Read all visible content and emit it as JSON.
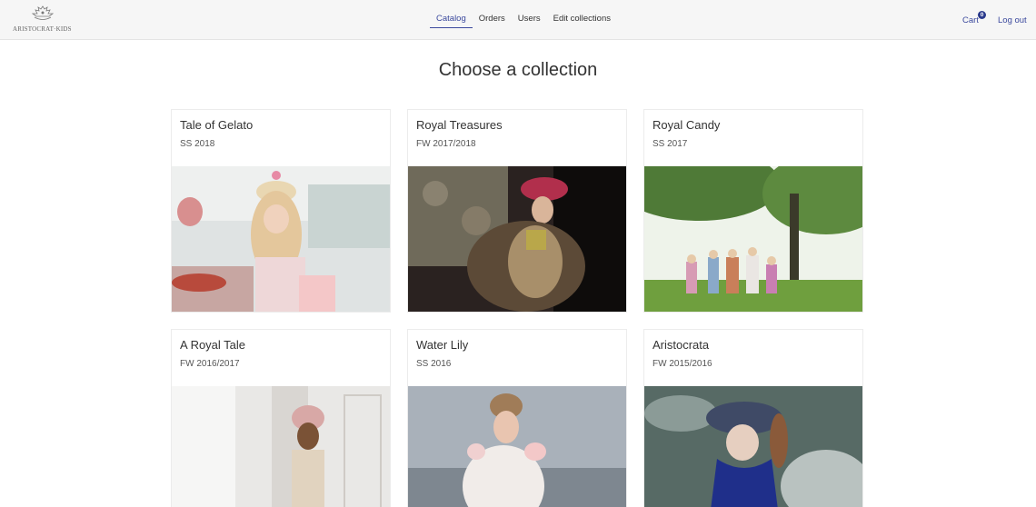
{
  "brand": {
    "logo_text": "ARISTOCRAT·KIDS"
  },
  "nav": {
    "items": [
      {
        "label": "Catalog",
        "active": true
      },
      {
        "label": "Orders"
      },
      {
        "label": "Users"
      },
      {
        "label": "Edit collections"
      }
    ],
    "cart_label": "Cart",
    "cart_count": "0",
    "logout_label": "Log out",
    "accent_color": "#3c4a9e"
  },
  "page": {
    "title": "Choose a collection"
  },
  "collections": [
    {
      "title": "Tale of Gelato",
      "season": "SS 2018"
    },
    {
      "title": "Royal Treasures",
      "season": "FW 2017/2018"
    },
    {
      "title": "Royal Candy",
      "season": "SS 2017"
    },
    {
      "title": "A Royal Tale",
      "season": "FW 2016/2017"
    },
    {
      "title": "Water Lily",
      "season": "SS 2016"
    },
    {
      "title": "Aristocrata",
      "season": "FW 2015/2016"
    }
  ]
}
